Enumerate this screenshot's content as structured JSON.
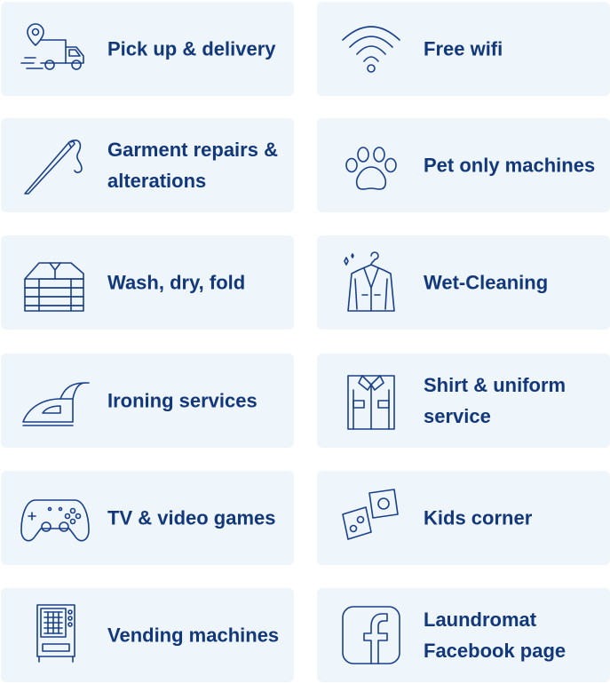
{
  "services": [
    {
      "label": "Pick up & delivery",
      "icon": "delivery-truck-icon"
    },
    {
      "label": "Free wifi",
      "icon": "wifi-icon"
    },
    {
      "label": "Garment repairs & alterations",
      "icon": "needle-thread-icon"
    },
    {
      "label": "Pet only machines",
      "icon": "paw-print-icon"
    },
    {
      "label": "Wash, dry, fold",
      "icon": "folded-clothes-icon"
    },
    {
      "label": "Wet-Cleaning",
      "icon": "suit-jacket-icon"
    },
    {
      "label": "Ironing services",
      "icon": "iron-icon"
    },
    {
      "label": "Shirt & uniform service",
      "icon": "shirt-icon"
    },
    {
      "label": "TV & video games",
      "icon": "game-controller-icon"
    },
    {
      "label": "Kids corner",
      "icon": "dice-icon"
    },
    {
      "label": "Vending machines",
      "icon": "vending-machine-icon"
    },
    {
      "label": "Laundromat Facebook page",
      "icon": "facebook-icon"
    }
  ],
  "colors": {
    "card_bg": "#eef6fb",
    "text": "#12377a",
    "icon_stroke": "#1a3f8a"
  }
}
